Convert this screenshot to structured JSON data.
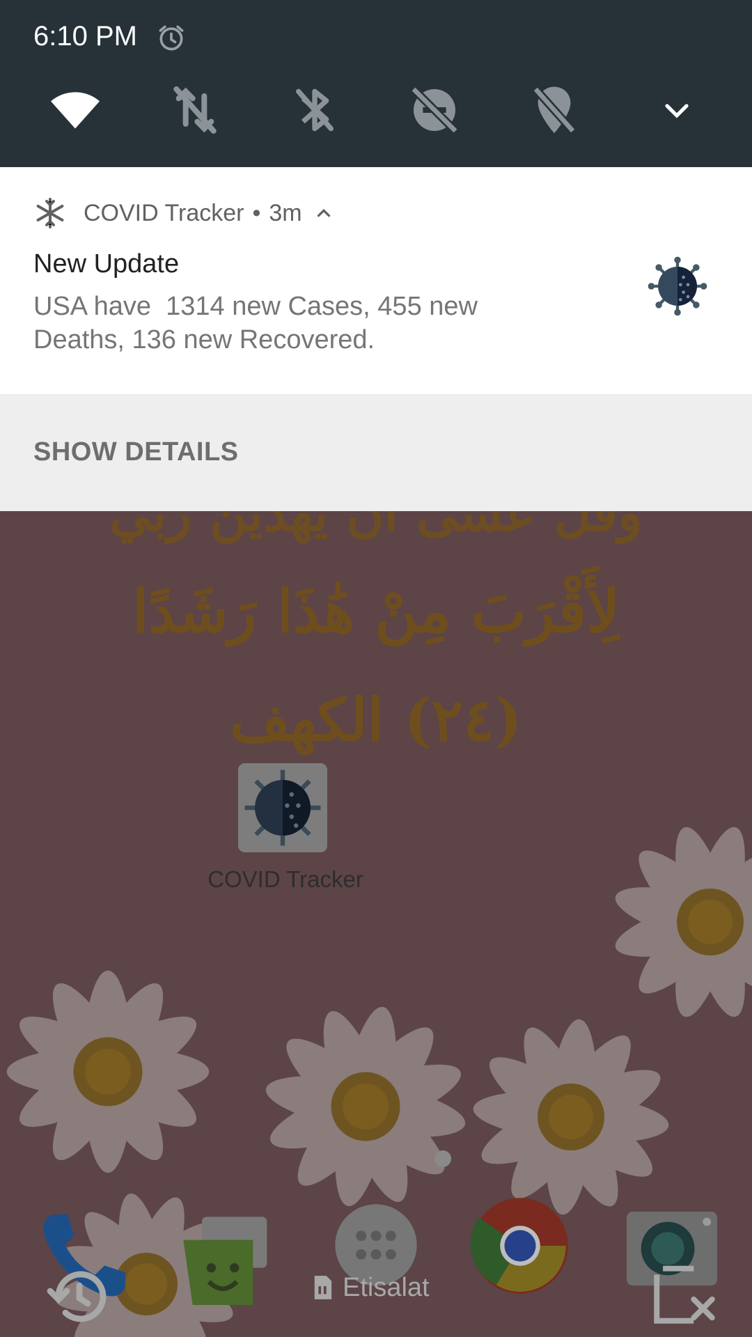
{
  "status_bar": {
    "time": "6:10 PM",
    "alarm_icon": "alarm-icon"
  },
  "quick_settings": {
    "tiles": [
      {
        "name": "wifi",
        "icon": "wifi-icon",
        "state": "on"
      },
      {
        "name": "mobile-data",
        "icon": "mobile-data-off-icon",
        "state": "off"
      },
      {
        "name": "bluetooth",
        "icon": "bluetooth-off-icon",
        "state": "off"
      },
      {
        "name": "do-not-disturb",
        "icon": "do-not-disturb-off-icon",
        "state": "off"
      },
      {
        "name": "location",
        "icon": "location-off-icon",
        "state": "off"
      }
    ],
    "expand_icon": "chevron-down-icon"
  },
  "notification": {
    "app_name": "COVID Tracker",
    "separator": "•",
    "time_ago": "3m",
    "title": "New Update",
    "text": "USA have  1314 new Cases, 455 new\nDeaths, 136 new Recovered.",
    "action": "SHOW DETAILS"
  },
  "home": {
    "wallpaper_text": [
      "وقل عسى أن يهدين ربي",
      "لِأَقْرَبَ مِنْ هَٰذَا رَشَدًا",
      "(٢٤) الكهف"
    ],
    "app_label": "COVID Tracker",
    "carrier": "Etisalat"
  },
  "colors": {
    "qs_background": "#263238",
    "notif_background": "#ffffff",
    "actions_background": "#eeeeee",
    "wallpaper_dim": "#5c4447"
  }
}
